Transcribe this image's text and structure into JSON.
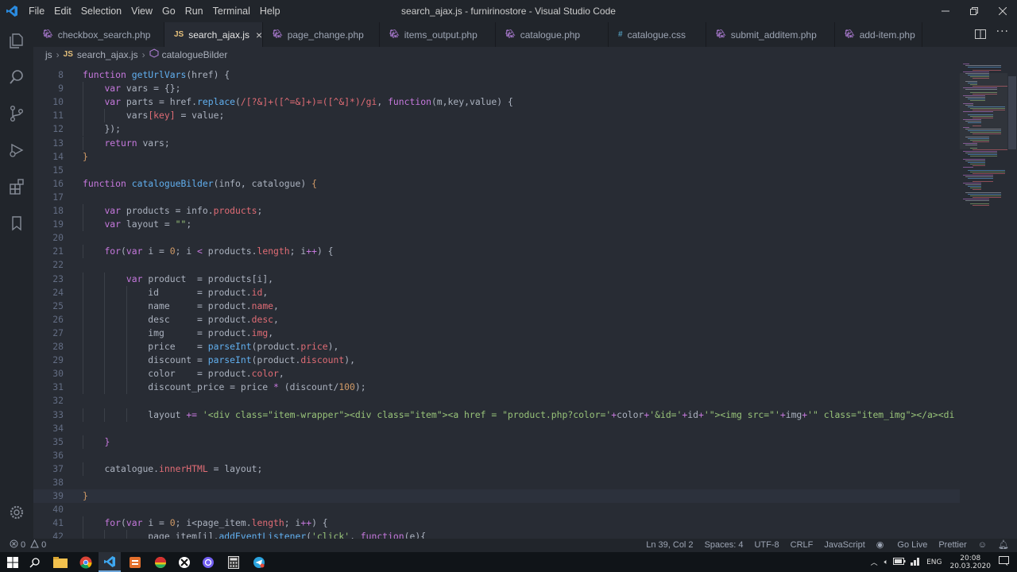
{
  "window": {
    "title": "search_ajax.js - furnirinostore - Visual Studio Code",
    "menu": [
      "File",
      "Edit",
      "Selection",
      "View",
      "Go",
      "Run",
      "Terminal",
      "Help"
    ]
  },
  "tabs": [
    {
      "label": "checkbox_search.php",
      "type": "php",
      "active": false
    },
    {
      "label": "search_ajax.js",
      "type": "js",
      "active": true
    },
    {
      "label": "page_change.php",
      "type": "php",
      "active": false
    },
    {
      "label": "items_output.php",
      "type": "php",
      "active": false
    },
    {
      "label": "catalogue.php",
      "type": "php",
      "active": false
    },
    {
      "label": "catalogue.css",
      "type": "css",
      "active": false
    },
    {
      "label": "submit_additem.php",
      "type": "php",
      "active": false
    },
    {
      "label": "add-item.php",
      "type": "php",
      "active": false
    }
  ],
  "breadcrumb": {
    "folder": "js",
    "file": "search_ajax.js",
    "symbol": "catalogueBilder",
    "js_badge": "JS"
  },
  "editor": {
    "current_line": 39,
    "lines": [
      {
        "n": 8,
        "indent": 0,
        "tokens": [
          [
            "k",
            "function "
          ],
          [
            "f",
            "getUrlVars"
          ],
          [
            "c",
            "(href) {"
          ]
        ]
      },
      {
        "n": 9,
        "indent": 1,
        "tokens": [
          [
            "k",
            "var "
          ],
          [
            "c",
            "vars = {};"
          ]
        ]
      },
      {
        "n": 10,
        "indent": 1,
        "tokens": [
          [
            "k",
            "var "
          ],
          [
            "c",
            "parts = href."
          ],
          [
            "f",
            "replace"
          ],
          [
            "c",
            "("
          ],
          [
            "p",
            "/[?&]+([^=&]+)=([^&]*)/gi"
          ],
          [
            "c",
            ", "
          ],
          [
            "k",
            "function"
          ],
          [
            "c",
            "(m,key,value) {"
          ]
        ]
      },
      {
        "n": 11,
        "indent": 2,
        "tokens": [
          [
            "c",
            "vars"
          ],
          [
            "p",
            "[key]"
          ],
          [
            "c",
            " = value;"
          ]
        ]
      },
      {
        "n": 12,
        "indent": 1,
        "tokens": [
          [
            "c",
            "});"
          ]
        ]
      },
      {
        "n": 13,
        "indent": 1,
        "tokens": [
          [
            "k",
            "return "
          ],
          [
            "c",
            "vars;"
          ]
        ]
      },
      {
        "n": 14,
        "indent": 0,
        "tokens": [
          [
            "n",
            "}"
          ]
        ]
      },
      {
        "n": 15,
        "indent": 0,
        "tokens": []
      },
      {
        "n": 16,
        "indent": 0,
        "tokens": [
          [
            "k",
            "function "
          ],
          [
            "f",
            "catalogueBilder"
          ],
          [
            "c",
            "(info, catalogue) "
          ],
          [
            "n",
            "{"
          ]
        ]
      },
      {
        "n": 17,
        "indent": 0,
        "tokens": []
      },
      {
        "n": 18,
        "indent": 1,
        "tokens": [
          [
            "k",
            "var "
          ],
          [
            "c",
            "products = info."
          ],
          [
            "p",
            "products"
          ],
          [
            "c",
            ";"
          ]
        ]
      },
      {
        "n": 19,
        "indent": 1,
        "tokens": [
          [
            "k",
            "var "
          ],
          [
            "c",
            "layout = "
          ],
          [
            "s",
            "\"\""
          ],
          [
            "c",
            ";"
          ]
        ]
      },
      {
        "n": 20,
        "indent": 0,
        "tokens": []
      },
      {
        "n": 21,
        "indent": 1,
        "tokens": [
          [
            "k",
            "for"
          ],
          [
            "c",
            "("
          ],
          [
            "k",
            "var "
          ],
          [
            "c",
            "i = "
          ],
          [
            "n",
            "0"
          ],
          [
            "c",
            "; i "
          ],
          [
            "k",
            "<"
          ],
          [
            "c",
            " products."
          ],
          [
            "p",
            "length"
          ],
          [
            "c",
            "; i"
          ],
          [
            "k",
            "++"
          ],
          [
            "c",
            ") {"
          ]
        ]
      },
      {
        "n": 22,
        "indent": 0,
        "tokens": []
      },
      {
        "n": 23,
        "indent": 2,
        "tokens": [
          [
            "k",
            "var "
          ],
          [
            "c",
            "product  = products[i],"
          ]
        ]
      },
      {
        "n": 24,
        "indent": 3,
        "tokens": [
          [
            "c",
            "id       = product."
          ],
          [
            "p",
            "id"
          ],
          [
            "c",
            ","
          ]
        ]
      },
      {
        "n": 25,
        "indent": 3,
        "tokens": [
          [
            "c",
            "name     = product."
          ],
          [
            "p",
            "name"
          ],
          [
            "c",
            ","
          ]
        ]
      },
      {
        "n": 26,
        "indent": 3,
        "tokens": [
          [
            "c",
            "desc     = product."
          ],
          [
            "p",
            "desc"
          ],
          [
            "c",
            ","
          ]
        ]
      },
      {
        "n": 27,
        "indent": 3,
        "tokens": [
          [
            "c",
            "img      = product."
          ],
          [
            "p",
            "img"
          ],
          [
            "c",
            ","
          ]
        ]
      },
      {
        "n": 28,
        "indent": 3,
        "tokens": [
          [
            "c",
            "price    = "
          ],
          [
            "f",
            "parseInt"
          ],
          [
            "c",
            "(product."
          ],
          [
            "p",
            "price"
          ],
          [
            "c",
            "),"
          ]
        ]
      },
      {
        "n": 29,
        "indent": 3,
        "tokens": [
          [
            "c",
            "discount = "
          ],
          [
            "f",
            "parseInt"
          ],
          [
            "c",
            "(product."
          ],
          [
            "p",
            "discount"
          ],
          [
            "c",
            "),"
          ]
        ]
      },
      {
        "n": 30,
        "indent": 3,
        "tokens": [
          [
            "c",
            "color    = product."
          ],
          [
            "p",
            "color"
          ],
          [
            "c",
            ","
          ]
        ]
      },
      {
        "n": 31,
        "indent": 3,
        "tokens": [
          [
            "c",
            "discount_price = price "
          ],
          [
            "k",
            "*"
          ],
          [
            "c",
            " (discount/"
          ],
          [
            "n",
            "100"
          ],
          [
            "c",
            ");"
          ]
        ]
      },
      {
        "n": 32,
        "indent": 0,
        "tokens": []
      },
      {
        "n": 33,
        "indent": 3,
        "tokens": [
          [
            "c",
            "layout "
          ],
          [
            "k",
            "+="
          ],
          [
            "c",
            " "
          ],
          [
            "s",
            "'<div class=\"item-wrapper\"><div class=\"item\"><a href = \"product.php?color='"
          ],
          [
            "k",
            "+"
          ],
          [
            "c",
            "color"
          ],
          [
            "k",
            "+"
          ],
          [
            "s",
            "'&id='"
          ],
          [
            "k",
            "+"
          ],
          [
            "c",
            "id"
          ],
          [
            "k",
            "+"
          ],
          [
            "s",
            "'\"><img src=\"'"
          ],
          [
            "k",
            "+"
          ],
          [
            "c",
            "img"
          ],
          [
            "k",
            "+"
          ],
          [
            "s",
            "'\" class=\"item_img\"></a><di"
          ]
        ]
      },
      {
        "n": 34,
        "indent": 0,
        "tokens": []
      },
      {
        "n": 35,
        "indent": 1,
        "tokens": [
          [
            "k",
            "}"
          ]
        ]
      },
      {
        "n": 36,
        "indent": 0,
        "tokens": []
      },
      {
        "n": 37,
        "indent": 1,
        "tokens": [
          [
            "c",
            "catalogue."
          ],
          [
            "p",
            "innerHTML"
          ],
          [
            "c",
            " = layout;"
          ]
        ]
      },
      {
        "n": 38,
        "indent": 0,
        "tokens": []
      },
      {
        "n": 39,
        "indent": 0,
        "tokens": [
          [
            "n",
            "}"
          ]
        ]
      },
      {
        "n": 40,
        "indent": 0,
        "tokens": []
      },
      {
        "n": 41,
        "indent": 1,
        "tokens": [
          [
            "k",
            "for"
          ],
          [
            "c",
            "("
          ],
          [
            "k",
            "var "
          ],
          [
            "c",
            "i = "
          ],
          [
            "n",
            "0"
          ],
          [
            "c",
            "; i<page_item."
          ],
          [
            "p",
            "length"
          ],
          [
            "c",
            "; i"
          ],
          [
            "k",
            "++"
          ],
          [
            "c",
            ") {"
          ]
        ]
      },
      {
        "n": 42,
        "indent": 3,
        "tokens": [
          [
            "c",
            "page_item[i]."
          ],
          [
            "f",
            "addEventListener"
          ],
          [
            "c",
            "("
          ],
          [
            "s",
            "'click'"
          ],
          [
            "c",
            ", "
          ],
          [
            "k",
            "function"
          ],
          [
            "c",
            "(e){"
          ]
        ]
      }
    ]
  },
  "status": {
    "errors": "0",
    "warnings": "0",
    "position": "Ln 39, Col 2",
    "spaces": "Spaces: 4",
    "encoding": "UTF-8",
    "eol": "CRLF",
    "language": "JavaScript",
    "golive": "Go Live",
    "prettier": "Prettier"
  },
  "taskbar": {
    "lang": "ENG",
    "time": "20:08",
    "date": "20.03.2020"
  },
  "colors": {
    "accent": "#61afef",
    "background": "#282c34",
    "chrome": "#21252b"
  }
}
